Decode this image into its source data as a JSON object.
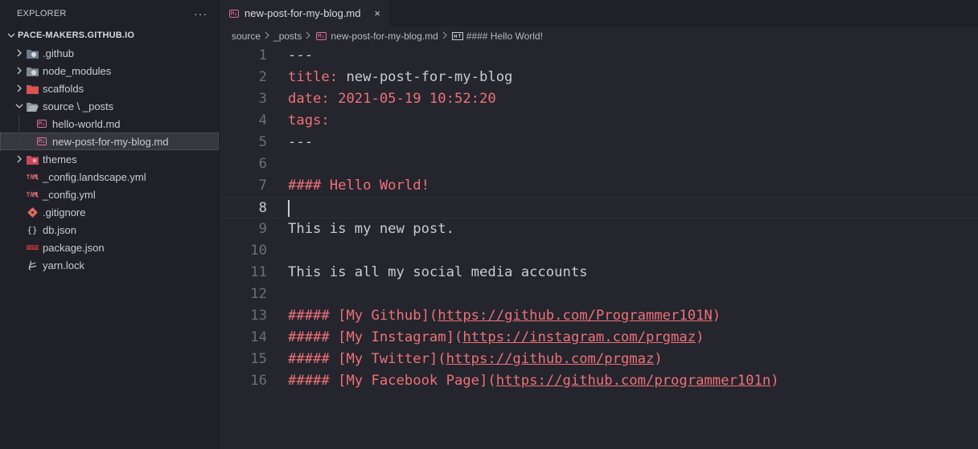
{
  "explorer": {
    "title": "EXPLORER",
    "more": "···",
    "root": "PACE-MAKERS.GITHUB.IO",
    "items": [
      {
        "label": ".github",
        "icon": "github-folder-icon"
      },
      {
        "label": "node_modules",
        "icon": "node-folder-icon"
      },
      {
        "label": "scaffolds",
        "icon": "folder-icon"
      },
      {
        "label": "source \\ _posts",
        "icon": "folder-open-icon"
      },
      {
        "label": "hello-world.md",
        "icon": "markdown-icon"
      },
      {
        "label": "new-post-for-my-blog.md",
        "icon": "markdown-icon"
      },
      {
        "label": "themes",
        "icon": "folder-icon"
      },
      {
        "label": "_config.landscape.yml",
        "icon": "yaml-icon"
      },
      {
        "label": "_config.yml",
        "icon": "yaml-icon"
      },
      {
        "label": ".gitignore",
        "icon": "git-icon"
      },
      {
        "label": "db.json",
        "icon": "json-icon"
      },
      {
        "label": "package.json",
        "icon": "npm-icon"
      },
      {
        "label": "yarn.lock",
        "icon": "yarn-icon"
      }
    ]
  },
  "tab": {
    "label": "new-post-for-my-blog.md",
    "close": "×"
  },
  "breadcrumb": [
    "source",
    "_posts",
    "new-post-for-my-blog.md",
    "#### Hello World!"
  ],
  "editor": {
    "lines": [
      {
        "n": "1",
        "t": "---"
      },
      {
        "n": "2",
        "k": "title:",
        "t": " new-post-for-my-blog"
      },
      {
        "n": "3",
        "k": "date:",
        "t": " 2021-05-19 10:52:20"
      },
      {
        "n": "4",
        "k": "tags:",
        "t": ""
      },
      {
        "n": "5",
        "t": "---"
      },
      {
        "n": "6",
        "t": ""
      },
      {
        "n": "7",
        "h": "#### Hello World!"
      },
      {
        "n": "8",
        "t": ""
      },
      {
        "n": "9",
        "t": "This is my new post."
      },
      {
        "n": "10",
        "t": ""
      },
      {
        "n": "11",
        "t": "This is all my social media accounts"
      },
      {
        "n": "12",
        "t": ""
      },
      {
        "n": "13",
        "p": "##### ",
        "lt": "[My Github]",
        "u": "https://github.com/Programmer101N"
      },
      {
        "n": "14",
        "p": "##### ",
        "lt": "[My Instagram]",
        "u": "https://instagram.com/prgmaz"
      },
      {
        "n": "15",
        "p": "##### ",
        "lt": "[My Twitter]",
        "u": "https://github.com/prgmaz"
      },
      {
        "n": "16",
        "p": "##### ",
        "lt": "[My Facebook Page]",
        "u": "https://github.com/programmer101n"
      }
    ]
  },
  "colors": {
    "background": "#24252d",
    "sidebar": "#202128",
    "accent": "#f07178",
    "text": "#c9ccd3"
  }
}
